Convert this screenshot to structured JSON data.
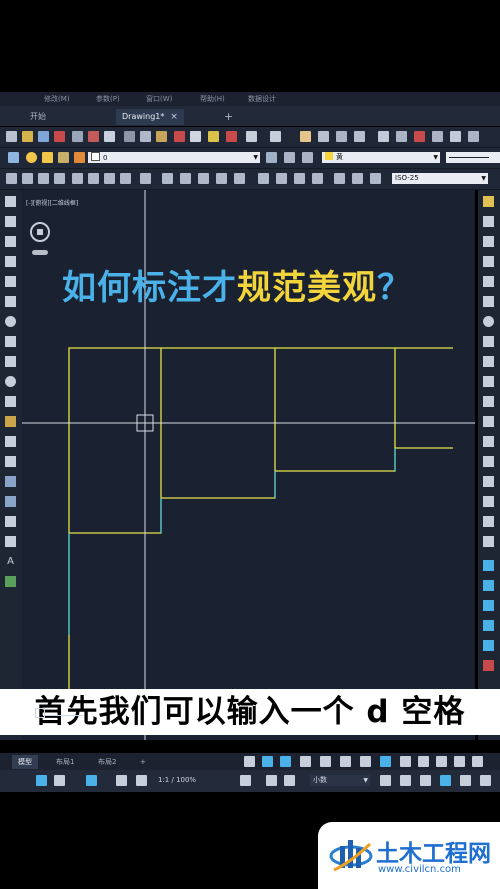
{
  "menu": {
    "items": [
      "修改(M)",
      "参数(P)",
      "窗口(W)",
      "帮助(H)",
      "数据设计"
    ]
  },
  "tabs": {
    "start": "开始",
    "drawing": "Drawing1*",
    "close": "×",
    "add": "+"
  },
  "layer": {
    "current": "0",
    "color_label": "黄",
    "color_hex": "#f2d43b"
  },
  "dim_style": {
    "current": "ISO-25"
  },
  "viewport": {
    "label": "[-][俯视][二维线框]"
  },
  "overlay": {
    "title_part1": "如何标注才",
    "title_part2": "规范美观",
    "title_mark": "？"
  },
  "subtitle": {
    "text": "首先我们可以输入一个 d 空格"
  },
  "layout_tabs": {
    "model": "模型",
    "layout1": "布局1",
    "layout2": "布局2",
    "add": "+"
  },
  "status": {
    "scale": "1:1 / 100%",
    "units": "小数"
  },
  "watermark": {
    "name": "土木工程网",
    "url": "www.civilcn.com"
  },
  "colors": {
    "cyan": "#4ab2e8",
    "yellow": "#f2d43b",
    "canvas": "#1a2130",
    "drawing_yellow": "#e6e24a",
    "drawing_cyan": "#3ec6d8"
  }
}
